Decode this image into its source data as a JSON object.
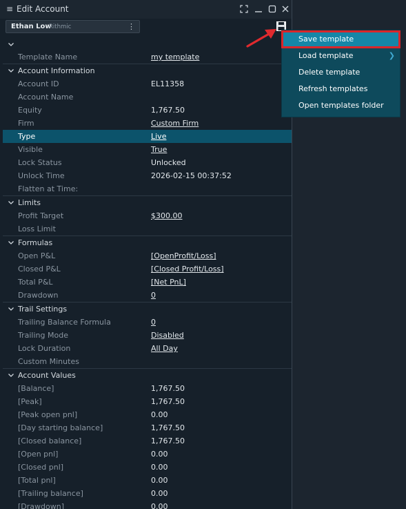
{
  "window": {
    "title": "Edit Account",
    "account_name": "Ethan Low",
    "broker": "Rithmic"
  },
  "template_row": {
    "label": "Template Name",
    "value": "my template"
  },
  "sections": [
    {
      "title": "Account Information",
      "rows": [
        {
          "label": "Account ID",
          "value": "EL11358",
          "link": false
        },
        {
          "label": "Account Name",
          "value": "",
          "link": false
        },
        {
          "label": "Equity",
          "value": "1,767.50",
          "link": false
        },
        {
          "label": "Firm",
          "value": "Custom Firm",
          "link": true
        },
        {
          "label": "Type",
          "value": "Live",
          "link": true,
          "selected": true
        },
        {
          "label": "Visible",
          "value": "True",
          "link": true
        },
        {
          "label": "Lock Status",
          "value": "Unlocked",
          "link": false
        },
        {
          "label": "Unlock Time",
          "value": "2026-02-15 00:37:52",
          "link": false
        },
        {
          "label": "Flatten at Time:",
          "value": "",
          "link": false
        }
      ]
    },
    {
      "title": "Limits",
      "rows": [
        {
          "label": "Profit Target",
          "value": "$300.00",
          "link": true
        },
        {
          "label": "Loss Limit",
          "value": "",
          "link": false
        }
      ]
    },
    {
      "title": "Formulas",
      "rows": [
        {
          "label": "Open P&L",
          "value": "[OpenProfit/Loss]",
          "link": true
        },
        {
          "label": "Closed P&L",
          "value": "[Closed Profit/Loss]",
          "link": true
        },
        {
          "label": "Total P&L",
          "value": "[Net PnL]",
          "link": true
        },
        {
          "label": "Drawdown",
          "value": "0",
          "link": true
        }
      ]
    },
    {
      "title": "Trail Settings",
      "rows": [
        {
          "label": "Trailing Balance Formula",
          "value": "0",
          "link": true
        },
        {
          "label": "Trailing Mode",
          "value": "Disabled",
          "link": true
        },
        {
          "label": "Lock Duration",
          "value": "All Day",
          "link": true
        },
        {
          "label": "Custom Minutes",
          "value": "",
          "link": false
        }
      ]
    },
    {
      "title": "Account Values",
      "rows": [
        {
          "label": "[Balance]",
          "value": "1,767.50",
          "link": false
        },
        {
          "label": "[Peak]",
          "value": "1,767.50",
          "link": false
        },
        {
          "label": "[Peak open pnl]",
          "value": "0.00",
          "link": false
        },
        {
          "label": "[Day starting balance]",
          "value": "1,767.50",
          "link": false
        },
        {
          "label": "[Closed balance]",
          "value": "1,767.50",
          "link": false
        },
        {
          "label": "[Open pnl]",
          "value": "0.00",
          "link": false
        },
        {
          "label": "[Closed pnl]",
          "value": "0.00",
          "link": false
        },
        {
          "label": "[Total pnl]",
          "value": "0.00",
          "link": false
        },
        {
          "label": "[Trailing balance]",
          "value": "0.00",
          "link": false
        },
        {
          "label": "[Drawdown]",
          "value": "0.00",
          "link": false
        }
      ]
    }
  ],
  "template_menu": {
    "items": [
      {
        "label": "Save template",
        "highlighted": true,
        "submenu": false
      },
      {
        "label": "Load template",
        "highlighted": false,
        "submenu": true
      },
      {
        "label": "Delete template",
        "highlighted": false,
        "submenu": false
      },
      {
        "label": "Refresh templates",
        "highlighted": false,
        "submenu": false
      },
      {
        "label": "Open templates folder",
        "highlighted": false,
        "submenu": false
      }
    ]
  },
  "icons": {
    "menu": "hamburger-icon",
    "fit": "fit-screen-icon",
    "minimize": "minimize-icon",
    "maximize": "maximize-icon",
    "close": "close-icon",
    "kebab": "kebab-menu-icon",
    "save": "save-floppy-icon",
    "annotation": "red-arrow-annotation"
  },
  "colors": {
    "panel_bg": "#16202a",
    "selected_row": "#0c536b",
    "menu_bg": "#0e4a5c",
    "menu_highlight": "#1586a7",
    "annotation_red": "#d9262a"
  }
}
